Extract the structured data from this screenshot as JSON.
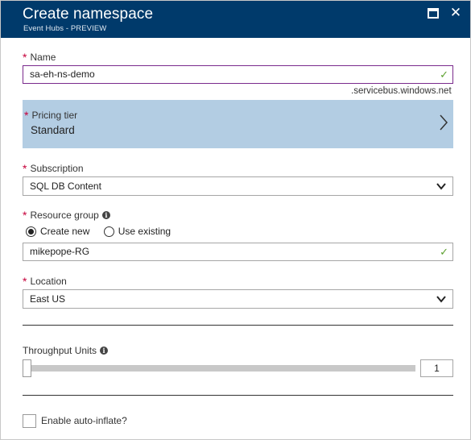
{
  "header": {
    "title": "Create namespace",
    "subtitle": "Event Hubs - PREVIEW"
  },
  "form": {
    "name": {
      "label": "Name",
      "value": "sa-eh-ns-demo",
      "suffix": ".servicebus.windows.net",
      "valid": true
    },
    "pricing_tier": {
      "label": "Pricing tier",
      "value": "Standard"
    },
    "subscription": {
      "label": "Subscription",
      "value": "SQL DB Content"
    },
    "resource_group": {
      "label": "Resource group",
      "options": [
        "Create new",
        "Use existing"
      ],
      "selected": "Create new",
      "value": "mikepope-RG",
      "valid": true
    },
    "location": {
      "label": "Location",
      "value": "East US"
    },
    "throughput_units": {
      "label": "Throughput Units",
      "value": "1",
      "slider_fraction": 0.0
    },
    "auto_inflate": {
      "label": "Enable auto-inflate?",
      "checked": false
    }
  },
  "colors": {
    "header_bg": "#003a6b",
    "required": "#c6003a",
    "selected_row": "#b3cde3",
    "valid_check": "#5ca02f"
  },
  "icons": [
    "maximize-icon",
    "close-icon",
    "checkmark-icon",
    "chevron-right-icon",
    "chevron-down-icon",
    "info-icon"
  ]
}
